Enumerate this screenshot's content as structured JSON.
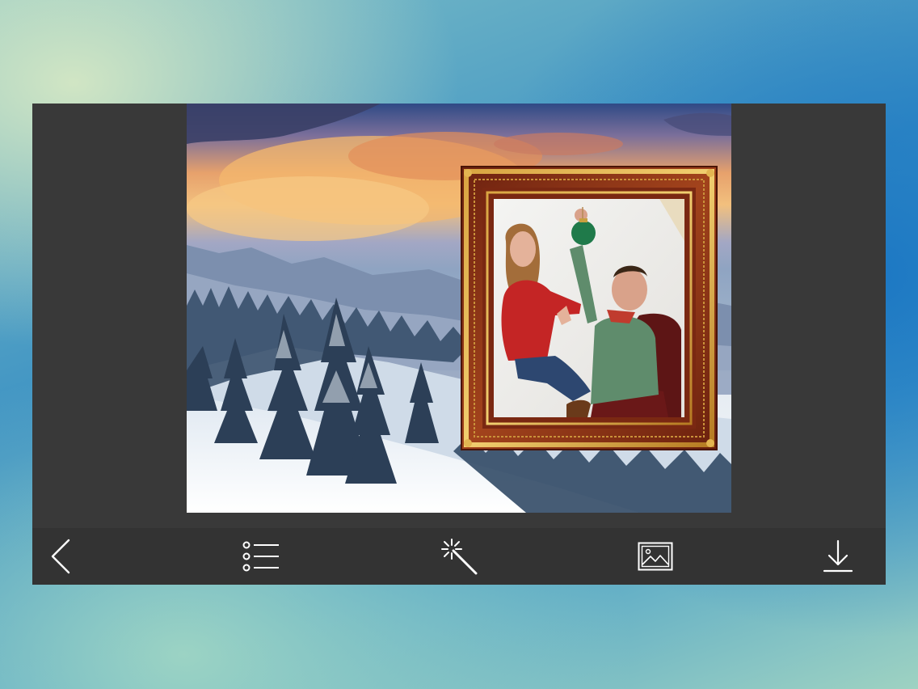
{
  "app": {
    "background_colors": {
      "panel": "#393939",
      "toolbar": "#333333",
      "icon": "#ffffff"
    }
  },
  "editor": {
    "scene": "winter-mountain-background",
    "overlay": "ornate-wooden-photo-frame",
    "frame_color": "#8a3214"
  },
  "toolbar": {
    "items": [
      {
        "name": "back",
        "icon": "chevron-left-icon"
      },
      {
        "name": "frames-list",
        "icon": "list-icon"
      },
      {
        "name": "effects",
        "icon": "magic-wand-icon"
      },
      {
        "name": "gallery",
        "icon": "image-icon"
      },
      {
        "name": "save",
        "icon": "download-icon"
      }
    ]
  }
}
